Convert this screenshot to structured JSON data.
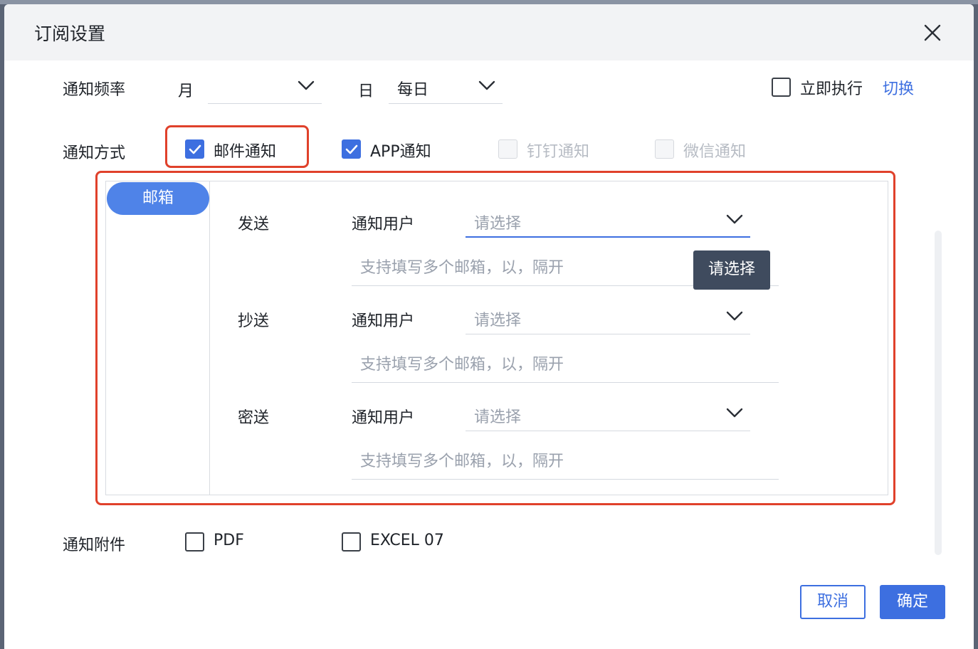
{
  "dialog": {
    "title": "订阅设置"
  },
  "frequency": {
    "label": "通知频率",
    "month_label": "月",
    "month_value": "",
    "day_label": "日",
    "day_value": "每日",
    "execute_now_label": "立即执行",
    "execute_now_checked": false,
    "switch_link": "切换"
  },
  "method": {
    "label": "通知方式",
    "options": [
      {
        "label": "邮件通知",
        "checked": true,
        "disabled": false
      },
      {
        "label": "APP通知",
        "checked": true,
        "disabled": false
      },
      {
        "label": "钉钉通知",
        "checked": false,
        "disabled": true
      },
      {
        "label": "微信通知",
        "checked": false,
        "disabled": true
      }
    ]
  },
  "mail": {
    "tab_label": "邮箱",
    "rows": [
      {
        "label": "发送",
        "user_label": "通知用户",
        "select_placeholder": "请选择",
        "email_placeholder": "支持填写多个邮箱，以，隔开"
      },
      {
        "label": "抄送",
        "user_label": "通知用户",
        "select_placeholder": "请选择",
        "email_placeholder": "支持填写多个邮箱，以，隔开"
      },
      {
        "label": "密送",
        "user_label": "通知用户",
        "select_placeholder": "请选择",
        "email_placeholder": "支持填写多个邮箱，以，隔开"
      }
    ],
    "tooltip": "请选择"
  },
  "attachment": {
    "label": "通知附件",
    "options": [
      {
        "label": "PDF",
        "checked": false
      },
      {
        "label": "EXCEL 07",
        "checked": false
      }
    ]
  },
  "footer": {
    "cancel_label": "取消",
    "ok_label": "确定"
  },
  "colors": {
    "accent": "#3d6fe0",
    "highlight": "#e0412b",
    "tooltip_bg": "#3f4b5e"
  },
  "icons": {
    "close": "close-icon",
    "chevron": "chevron-down-icon",
    "check": "check-icon"
  }
}
